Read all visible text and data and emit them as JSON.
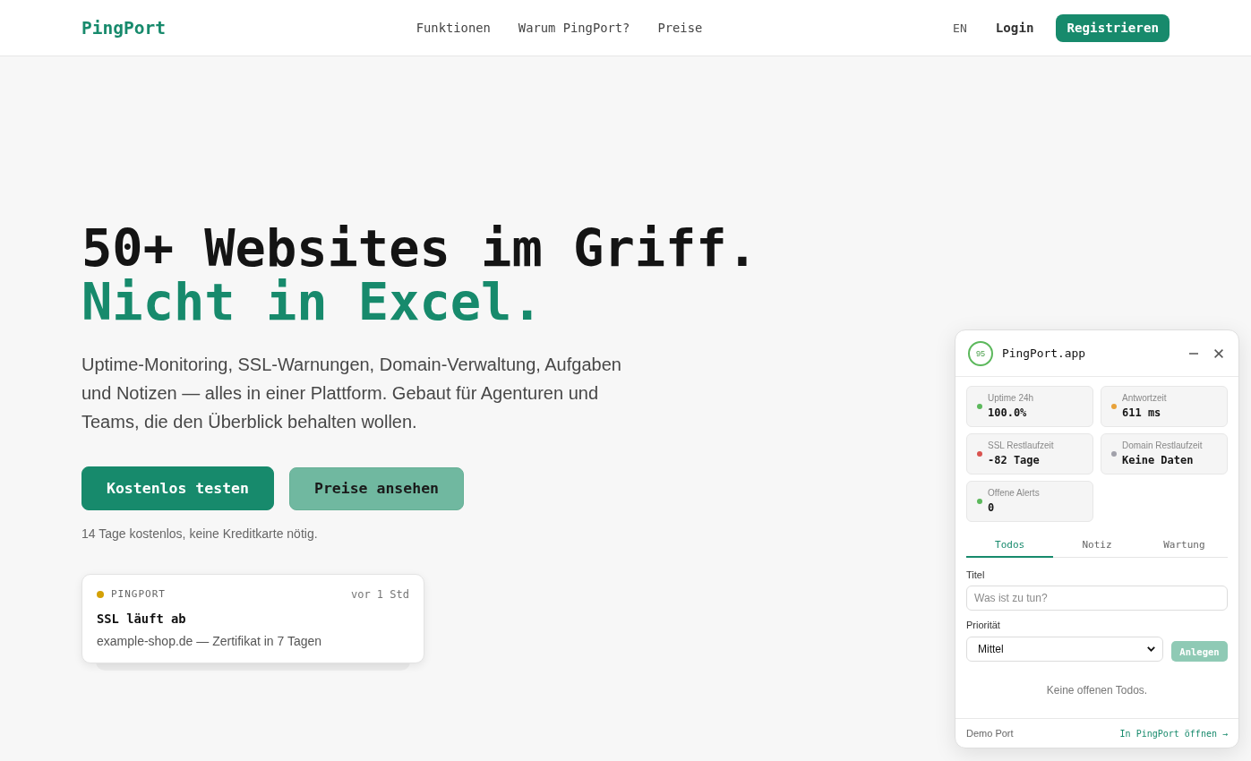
{
  "header": {
    "logo": "PingPort",
    "nav": [
      "Funktionen",
      "Warum PingPort?",
      "Preise"
    ],
    "language": "EN",
    "login": "Login",
    "signup": "Registrieren"
  },
  "hero": {
    "headline": "50+ Websites im Griff.",
    "headline_accent": "Nicht in Excel.",
    "description": "Uptime-Monitoring, SSL-Warnungen, Domain-Verwaltung, Aufgaben und Notizen — alles in einer Plattform. Gebaut für Agenturen und Teams, die den Überblick behalten wollen.",
    "buttons": [
      {
        "label": "Kostenlos testen",
        "kind": "primary"
      },
      {
        "label": "Preise ansehen",
        "kind": "secondary"
      }
    ],
    "note": "14 Tage kostenlos, keine Kreditkarte nötig."
  },
  "notification": {
    "source": "PINGPORT",
    "time": "vor 1 Std",
    "title": "SSL läuft ab",
    "message": "example-shop.de — Zertifikat in 7 Tagen"
  },
  "widget": {
    "score": "95",
    "title": "PingPort.app",
    "metrics": [
      {
        "label": "Uptime 24h",
        "value": "100.0%",
        "color": "#5cb85c"
      },
      {
        "label": "Antwortzeit",
        "value": "611 ms",
        "color": "#e8a23a"
      },
      {
        "label": "SSL Restlaufzeit",
        "value": "-82 Tage",
        "color": "#d9534f"
      },
      {
        "label": "Domain Restlaufzeit",
        "value": "Keine Daten",
        "color": "#a1a1aa"
      },
      {
        "label": "Offene Alerts",
        "value": "0",
        "color": "#5cb85c"
      }
    ],
    "tabs": [
      {
        "label": "Todos",
        "selected": true
      },
      {
        "label": "Notiz",
        "selected": false
      },
      {
        "label": "Wartung",
        "selected": false
      }
    ],
    "form": {
      "title_label": "Titel",
      "title_placeholder": "Was ist zu tun?",
      "priority_label": "Priorität",
      "priority_value": "Mittel",
      "submit": {
        "label": "Anlegen",
        "disabled": true
      }
    },
    "empty_message": "Keine offenen Todos.",
    "footer": {
      "workspace": "Demo Port",
      "link": "In PingPort öffnen →"
    }
  }
}
